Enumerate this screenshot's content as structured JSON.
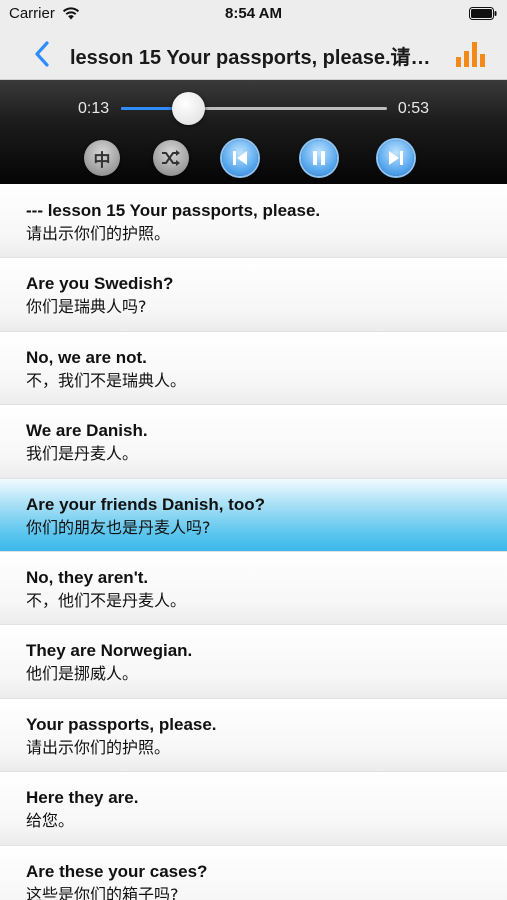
{
  "status_bar": {
    "carrier": "Carrier",
    "time": "8:54 AM"
  },
  "nav": {
    "title": "lesson 15  Your passports, please.请…"
  },
  "player": {
    "elapsed": "0:13",
    "total": "0:53",
    "progress": 0.25,
    "language_button": "中",
    "colors": {
      "accent": "#2f8cff",
      "control_blue": "#5aa9ee"
    }
  },
  "list": {
    "active_index": 4,
    "items": [
      {
        "en": "--- lesson 15  Your passports, please.",
        "cn": "请出示你们的护照。"
      },
      {
        "en": "Are you Swedish?",
        "cn": "你们是瑞典人吗?"
      },
      {
        "en": "No, we are not.",
        "cn": "不，我们不是瑞典人。"
      },
      {
        "en": "We are Danish.",
        "cn": "我们是丹麦人。"
      },
      {
        "en": "Are your friends Danish, too?",
        "cn": "你们的朋友也是丹麦人吗?"
      },
      {
        "en": "No, they aren't.",
        "cn": "不，他们不是丹麦人。"
      },
      {
        "en": "They are Norwegian.",
        "cn": "他们是挪威人。"
      },
      {
        "en": "Your passports, please.",
        "cn": "请出示你们的护照。"
      },
      {
        "en": "Here they are.",
        "cn": "给您。"
      },
      {
        "en": "Are these your cases?",
        "cn": "这些是你们的箱子吗?"
      }
    ]
  }
}
